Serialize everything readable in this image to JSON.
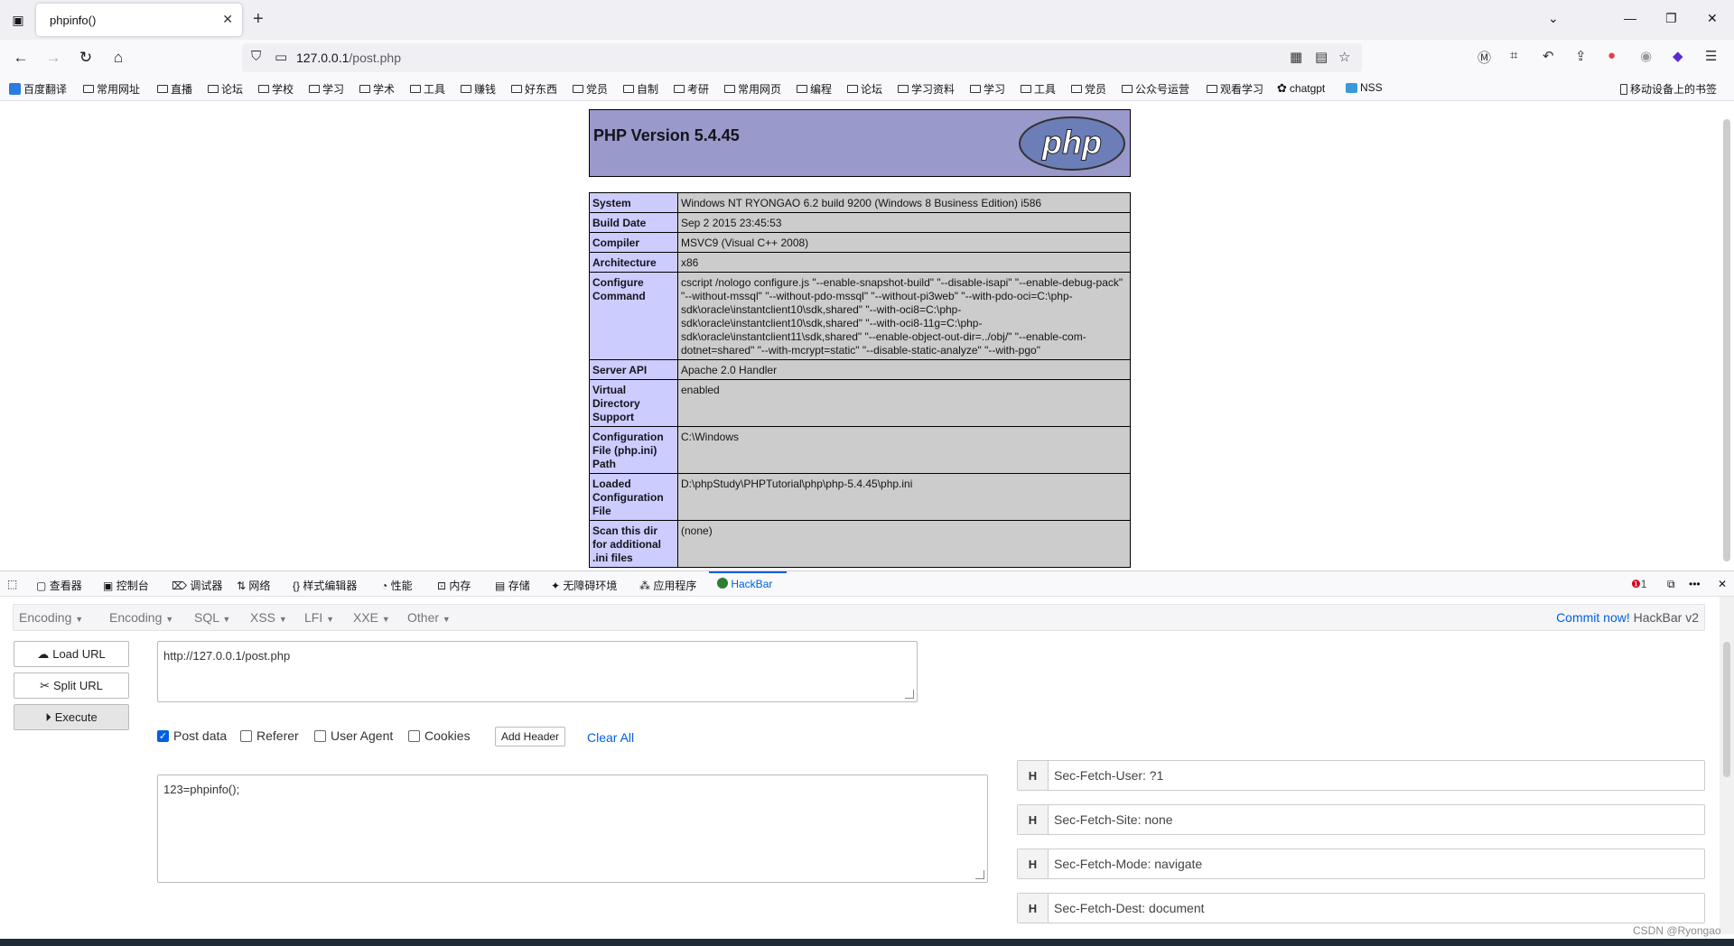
{
  "browser": {
    "tab_title": "phpinfo()",
    "url_host": "127.0.0.1",
    "url_path": "/post.php"
  },
  "bookmarks": {
    "items": [
      "百度翻译",
      "常用网址",
      "直播",
      "论坛",
      "学校",
      "学习",
      "学术",
      "工具",
      "赚钱",
      "好东西",
      "党员",
      "自制",
      "考研",
      "常用网页",
      "编程",
      "论坛",
      "学习资料",
      "学习",
      "工具",
      "党员",
      "公众号运营",
      "观看学习",
      "chatgpt",
      "NSS"
    ],
    "mobile": "移动设备上的书签"
  },
  "phpinfo": {
    "title": "PHP Version 5.4.45",
    "logo_text": "php",
    "rows": [
      {
        "k": "System",
        "v": "Windows NT RYONGAO 6.2 build 9200 (Windows 8 Business Edition) i586"
      },
      {
        "k": "Build Date",
        "v": "Sep 2 2015 23:45:53"
      },
      {
        "k": "Compiler",
        "v": "MSVC9 (Visual C++ 2008)"
      },
      {
        "k": "Architecture",
        "v": "x86"
      },
      {
        "k": "Configure Command",
        "v": "cscript /nologo configure.js \"--enable-snapshot-build\" \"--disable-isapi\" \"--enable-debug-pack\" \"--without-mssql\" \"--without-pdo-mssql\" \"--without-pi3web\" \"--with-pdo-oci=C:\\php-sdk\\oracle\\instantclient10\\sdk,shared\" \"--with-oci8=C:\\php-sdk\\oracle\\instantclient10\\sdk,shared\" \"--with-oci8-11g=C:\\php-sdk\\oracle\\instantclient11\\sdk,shared\" \"--enable-object-out-dir=../obj/\" \"--enable-com-dotnet=shared\" \"--with-mcrypt=static\" \"--disable-static-analyze\" \"--with-pgo\""
      },
      {
        "k": "Server API",
        "v": "Apache 2.0 Handler"
      },
      {
        "k": "Virtual Directory Support",
        "v": "enabled"
      },
      {
        "k": "Configuration File (php.ini) Path",
        "v": "C:\\Windows"
      },
      {
        "k": "Loaded Configuration File",
        "v": "D:\\phpStudy\\PHPTutorial\\php\\php-5.4.45\\php.ini"
      },
      {
        "k": "Scan this dir for additional .ini files",
        "v": "(none)"
      }
    ]
  },
  "devtools": {
    "tabs": [
      "查看器",
      "控制台",
      "调试器",
      "网络",
      "样式编辑器",
      "性能",
      "内存",
      "存储",
      "无障碍环境",
      "应用程序",
      "HackBar"
    ],
    "error_count": "1"
  },
  "hackbar": {
    "menus": [
      "Encoding",
      "Encoding",
      "SQL",
      "XSS",
      "LFI",
      "XXE",
      "Other"
    ],
    "commit_link": "Commit now!",
    "commit_suffix": "HackBar v2",
    "load_url": "Load URL",
    "split_url": "Split URL",
    "execute": "Execute",
    "url_value": "http://127.0.0.1/post.php",
    "options": [
      "Post data",
      "Referer",
      "User Agent",
      "Cookies"
    ],
    "add_header": "Add Header",
    "clear_all": "Clear All",
    "post_value": "123=phpinfo();",
    "headers": [
      {
        "h": "H",
        "v": "Sec-Fetch-User: ?1"
      },
      {
        "h": "H",
        "v": "Sec-Fetch-Site: none"
      },
      {
        "h": "H",
        "v": "Sec-Fetch-Mode: navigate"
      },
      {
        "h": "H",
        "v": "Sec-Fetch-Dest: document"
      }
    ]
  },
  "watermark": "CSDN @Ryongao"
}
